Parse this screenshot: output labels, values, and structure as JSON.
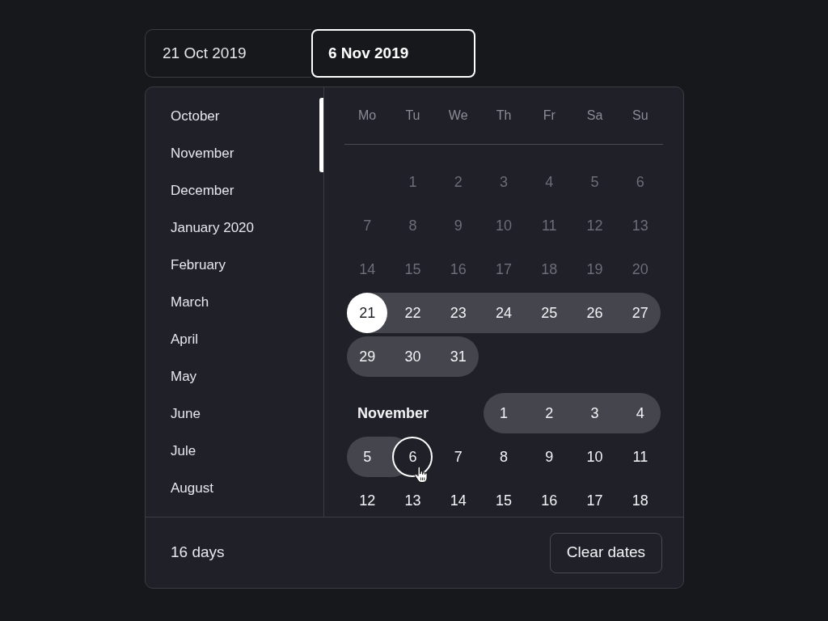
{
  "date_range": {
    "start": {
      "value": "21 Oct 2019",
      "selected": false
    },
    "end": {
      "value": "6 Nov 2019",
      "selected": true
    }
  },
  "month_list": [
    "October",
    "November",
    "December",
    "January 2020",
    "February",
    "March",
    "April",
    "May",
    "June",
    "Jule",
    "August"
  ],
  "calendar": {
    "weekdays": [
      "Mo",
      "Tu",
      "We",
      "Th",
      "Fr",
      "Sa",
      "Su"
    ],
    "months": [
      {
        "weeks": [
          [
            {
              "label": "1",
              "kind": "muted"
            },
            {
              "label": "2",
              "kind": "muted"
            },
            {
              "label": "3",
              "kind": "muted"
            },
            {
              "label": "4",
              "kind": "muted"
            },
            {
              "label": "5",
              "kind": "muted"
            },
            {
              "label": "6",
              "kind": "muted"
            }
          ],
          [
            {
              "label": "7",
              "kind": "muted"
            },
            {
              "label": "8",
              "kind": "muted"
            },
            {
              "label": "9",
              "kind": "muted"
            },
            {
              "label": "10",
              "kind": "muted"
            },
            {
              "label": "11",
              "kind": "muted"
            },
            {
              "label": "12",
              "kind": "muted"
            },
            {
              "label": "13",
              "kind": "muted"
            }
          ],
          [
            {
              "label": "14",
              "kind": "muted"
            },
            {
              "label": "15",
              "kind": "muted"
            },
            {
              "label": "16",
              "kind": "muted"
            },
            {
              "label": "17",
              "kind": "muted"
            },
            {
              "label": "18",
              "kind": "muted"
            },
            {
              "label": "19",
              "kind": "muted"
            },
            {
              "label": "20",
              "kind": "muted"
            }
          ],
          [
            {
              "label": "21",
              "kind": "range_start"
            },
            {
              "label": "22",
              "kind": "range"
            },
            {
              "label": "23",
              "kind": "range"
            },
            {
              "label": "24",
              "kind": "range"
            },
            {
              "label": "25",
              "kind": "range"
            },
            {
              "label": "26",
              "kind": "range"
            },
            {
              "label": "27",
              "kind": "range"
            }
          ],
          [
            {
              "label": "29",
              "kind": "range"
            },
            {
              "label": "30",
              "kind": "range"
            },
            {
              "label": "31",
              "kind": "range"
            }
          ]
        ]
      },
      {
        "label": "November",
        "weeks": [
          [
            {
              "label": "1",
              "kind": "range"
            },
            {
              "label": "2",
              "kind": "range"
            },
            {
              "label": "3",
              "kind": "range"
            },
            {
              "label": "4",
              "kind": "range"
            }
          ],
          [
            {
              "label": "5",
              "kind": "range"
            },
            {
              "label": "6",
              "kind": "range_end"
            },
            {
              "label": "7",
              "kind": "plain"
            },
            {
              "label": "8",
              "kind": "plain"
            },
            {
              "label": "9",
              "kind": "plain"
            },
            {
              "label": "10",
              "kind": "plain"
            },
            {
              "label": "11",
              "kind": "plain"
            }
          ],
          [
            {
              "label": "12",
              "kind": "plain"
            },
            {
              "label": "13",
              "kind": "plain"
            },
            {
              "label": "14",
              "kind": "plain"
            },
            {
              "label": "15",
              "kind": "plain"
            },
            {
              "label": "16",
              "kind": "plain"
            },
            {
              "label": "17",
              "kind": "plain"
            },
            {
              "label": "18",
              "kind": "plain"
            }
          ]
        ]
      }
    ]
  },
  "footer": {
    "duration": "16 days",
    "clear_button": "Clear dates"
  }
}
